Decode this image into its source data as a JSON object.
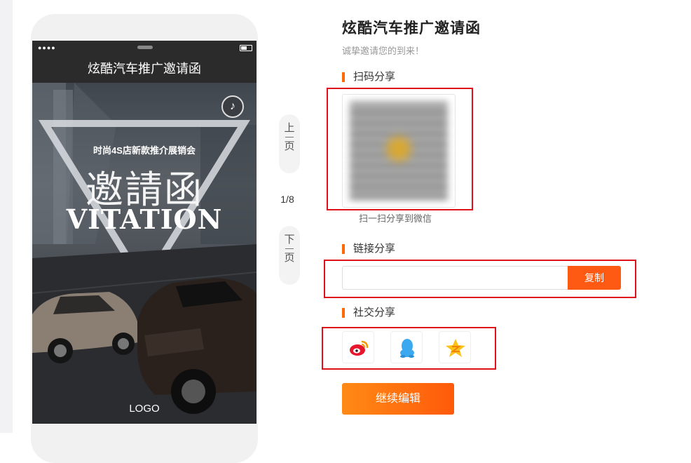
{
  "phone": {
    "nav_title": "炫酷汽车推广邀请函",
    "poster": {
      "subtitle": "时尚4S店新款推介展销会",
      "title_cn": "邀請函",
      "title_en": "VITATION",
      "logo": "LOGO"
    }
  },
  "pager": {
    "prev_top": "上",
    "prev_bottom": "页",
    "next_top": "下",
    "next_bottom": "页",
    "page_indicator": "1/8"
  },
  "panel": {
    "title": "炫酷汽车推广邀请函",
    "subtitle": "诚挚邀请您的到来！",
    "qr_section": "扫码分享",
    "qr_caption": "扫一扫分享到微信",
    "link_section": "链接分享",
    "link_value": "",
    "copy_label": "复制",
    "social_section": "社交分享",
    "continue_label": "继续编辑"
  },
  "icons": {
    "music": "music-note-icon",
    "weibo": "weibo-icon",
    "qq": "qq-icon",
    "qzone": "qzone-icon"
  },
  "colors": {
    "accent": "#ff5a14",
    "annotation": "#e0101a"
  }
}
